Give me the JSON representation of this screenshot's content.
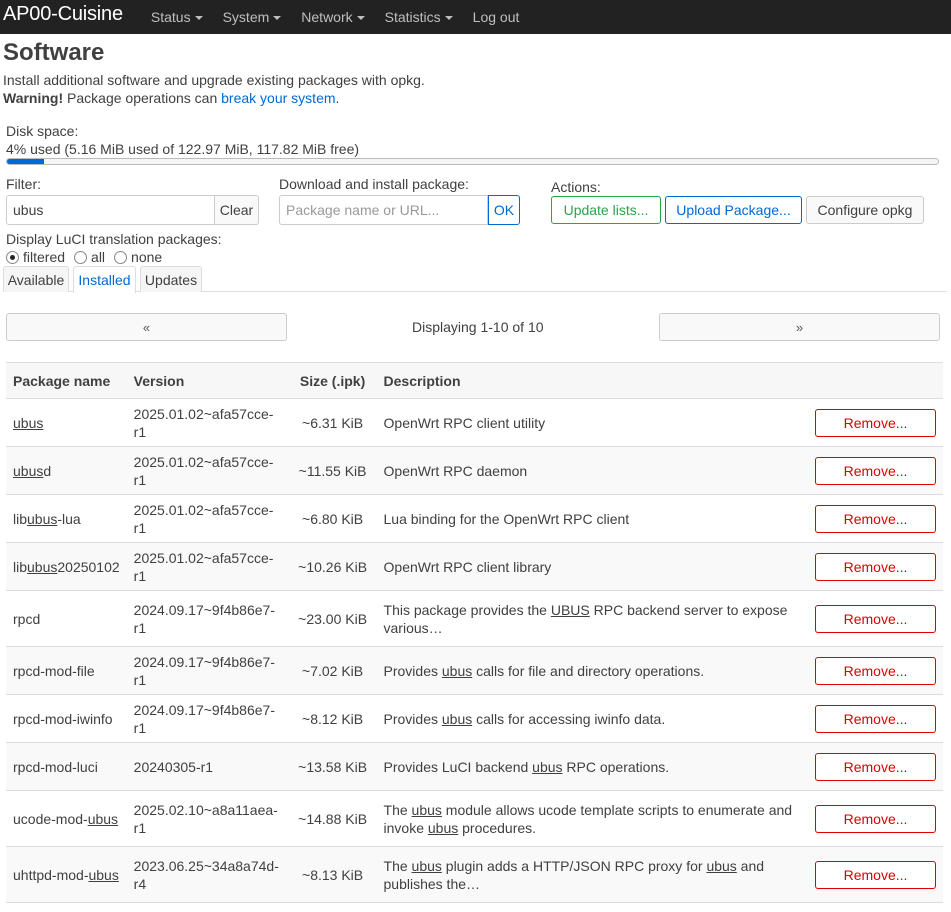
{
  "header": {
    "brand": "AP00-Cuisine",
    "menu": [
      {
        "label": "Status",
        "dropdown": true
      },
      {
        "label": "System",
        "dropdown": true
      },
      {
        "label": "Network",
        "dropdown": true
      },
      {
        "label": "Statistics",
        "dropdown": true
      },
      {
        "label": "Log out",
        "dropdown": false
      }
    ]
  },
  "page": {
    "title": "Software",
    "description": "Install additional software and upgrade existing packages with opkg.",
    "warning_label": "Warning!",
    "warning_text": " Package operations can ",
    "warning_link": "break your system",
    "warning_end": "."
  },
  "disk": {
    "label": "Disk space:",
    "usage_text": "4% used (5.16 MiB used of 122.97 MiB, 117.82 MiB free)",
    "used_percent": 4
  },
  "filter": {
    "label": "Filter:",
    "value": "ubus",
    "clear_label": "Clear"
  },
  "install": {
    "label": "Download and install package:",
    "placeholder": "Package name or URL...",
    "ok_label": "OK"
  },
  "actions": {
    "label": "Actions:",
    "update_lists": "Update lists...",
    "upload_package": "Upload Package...",
    "configure": "Configure opkg"
  },
  "translation": {
    "label": "Display LuCI translation packages:",
    "options": [
      "filtered",
      "all",
      "none"
    ],
    "selected": "filtered"
  },
  "tabs": [
    {
      "label": "Available",
      "active": false
    },
    {
      "label": "Installed",
      "active": true
    },
    {
      "label": "Updates",
      "active": false
    }
  ],
  "pager": {
    "prev": "«",
    "next": "»",
    "info": "Displaying 1-10 of 10"
  },
  "table": {
    "headers": [
      "Package name",
      "Version",
      "Size (.ipk)",
      "Description",
      ""
    ],
    "remove_label": "Remove...",
    "rows": [
      {
        "name": [
          [
            "",
            ""
          ],
          [
            "u",
            "ubus"
          ],
          [
            "",
            ""
          ]
        ],
        "version": "2025.01.02~afa57cce-r1",
        "size": "~6.31 KiB",
        "description": [
          [
            "",
            "OpenWrt RPC client utility"
          ]
        ]
      },
      {
        "name": [
          [
            "u",
            "ubus"
          ],
          [
            "",
            "d"
          ]
        ],
        "version": "2025.01.02~afa57cce-r1",
        "size": "~11.55 KiB",
        "description": [
          [
            "",
            "OpenWrt RPC daemon"
          ]
        ]
      },
      {
        "name": [
          [
            "",
            "lib"
          ],
          [
            "u",
            "ubus"
          ],
          [
            "",
            "-lua"
          ]
        ],
        "version": "2025.01.02~afa57cce-r1",
        "size": "~6.80 KiB",
        "description": [
          [
            "",
            "Lua binding for the OpenWrt RPC client"
          ]
        ]
      },
      {
        "name": [
          [
            "",
            "lib"
          ],
          [
            "u",
            "ubus"
          ],
          [
            "",
            "20250102"
          ]
        ],
        "version": "2025.01.02~afa57cce-r1",
        "size": "~10.26 KiB",
        "description": [
          [
            "",
            "OpenWrt RPC client library"
          ]
        ]
      },
      {
        "name": [
          [
            "",
            "rpcd"
          ]
        ],
        "version": "2024.09.17~9f4b86e7-r1",
        "size": "~23.00 KiB",
        "description": [
          [
            "",
            "This package provides the "
          ],
          [
            "u",
            "UBUS"
          ],
          [
            "",
            " RPC backend server to expose various…"
          ]
        ]
      },
      {
        "name": [
          [
            "",
            "rpcd-mod-file"
          ]
        ],
        "version": "2024.09.17~9f4b86e7-r1",
        "size": "~7.02 KiB",
        "description": [
          [
            "",
            "Provides "
          ],
          [
            "u",
            "ubus"
          ],
          [
            "",
            " calls for file and directory operations."
          ]
        ]
      },
      {
        "name": [
          [
            "",
            "rpcd-mod-iwinfo"
          ]
        ],
        "version": "2024.09.17~9f4b86e7-r1",
        "size": "~8.12 KiB",
        "description": [
          [
            "",
            "Provides "
          ],
          [
            "u",
            "ubus"
          ],
          [
            "",
            " calls for accessing iwinfo data."
          ]
        ]
      },
      {
        "name": [
          [
            "",
            "rpcd-mod-luci"
          ]
        ],
        "version": "20240305-r1",
        "size": "~13.58 KiB",
        "description": [
          [
            "",
            "Provides LuCI backend "
          ],
          [
            "u",
            "ubus"
          ],
          [
            "",
            " RPC operations."
          ]
        ]
      },
      {
        "name": [
          [
            "",
            "ucode-mod-"
          ],
          [
            "u",
            "ubus"
          ]
        ],
        "version": "2025.02.10~a8a11aea-r1",
        "size": "~14.88 KiB",
        "description": [
          [
            "",
            "The "
          ],
          [
            "u",
            "ubus"
          ],
          [
            "",
            " module allows ucode template scripts to enumerate and invoke "
          ],
          [
            "u",
            "ubus"
          ],
          [
            "",
            " procedures."
          ]
        ]
      },
      {
        "name": [
          [
            "",
            "uhttpd-mod-"
          ],
          [
            "u",
            "ubus"
          ]
        ],
        "version": "2023.06.25~34a8a74d-r4",
        "size": "~8.13 KiB",
        "description": [
          [
            "",
            "The "
          ],
          [
            "u",
            "ubus"
          ],
          [
            "",
            " plugin adds a HTTP/JSON RPC proxy for "
          ],
          [
            "u",
            "ubus"
          ],
          [
            "",
            " and publishes the…"
          ]
        ]
      }
    ]
  }
}
